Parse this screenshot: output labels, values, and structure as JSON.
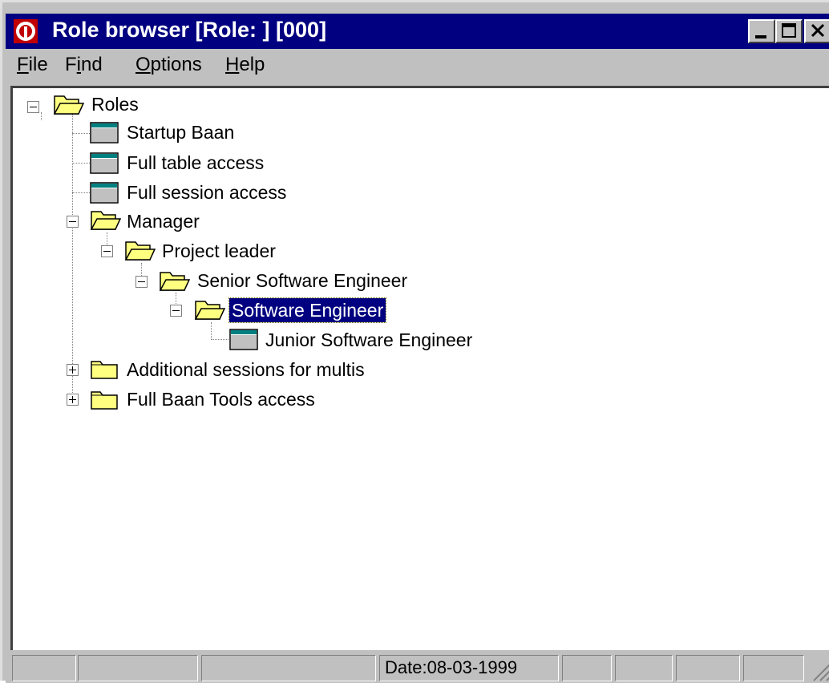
{
  "window": {
    "title": "Role browser [Role: ] [000]",
    "buttons": {
      "minimize": "_",
      "maximize": "□",
      "close": "×"
    }
  },
  "menu": {
    "items": [
      {
        "label": "File",
        "mnemonic": "F"
      },
      {
        "label": "Find",
        "mnemonic": "i"
      },
      {
        "label": "Options",
        "mnemonic": "O"
      },
      {
        "label": "Help",
        "mnemonic": "H"
      }
    ]
  },
  "tree": {
    "root": "Roles",
    "nodes": [
      {
        "label": "Startup Baan",
        "type": "role"
      },
      {
        "label": "Full table access",
        "type": "role"
      },
      {
        "label": "Full session access",
        "type": "role"
      },
      {
        "label": "Manager",
        "type": "folder-open"
      },
      {
        "label": "Project leader",
        "type": "folder-open"
      },
      {
        "label": "Senior Software Engineer",
        "type": "folder-open"
      },
      {
        "label": "Software Engineer",
        "type": "folder-open",
        "selected": true
      },
      {
        "label": "Junior Software Engineer",
        "type": "role"
      },
      {
        "label": "Additional sessions for multis",
        "type": "folder-closed"
      },
      {
        "label": "Full Baan Tools access",
        "type": "folder-closed"
      }
    ]
  },
  "status": {
    "date": "Date:08-03-1999"
  },
  "colors": {
    "titlebar": "#000080",
    "selection": "#000080",
    "folder": "#ffff80",
    "chrome": "#c0c0c0"
  }
}
